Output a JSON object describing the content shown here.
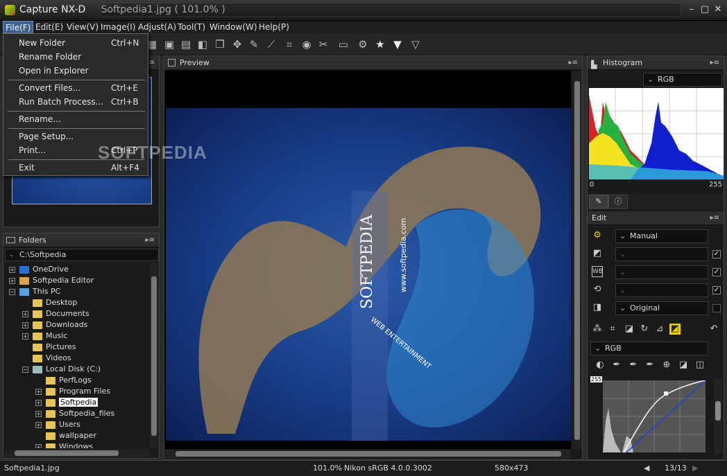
{
  "window": {
    "title": "Capture NX-D     Softpedia1.jpg ( 101.0% )"
  },
  "menubar": [
    "File(F)",
    "Edit(E)",
    "View(V)",
    "Image(I)",
    "Adjust(A)",
    "Tool(T)",
    "Window(W)",
    "Help(P)"
  ],
  "file_menu": {
    "items": [
      {
        "label": "New Folder",
        "key": "Ctrl+N"
      },
      {
        "label": "Rename Folder",
        "key": ""
      },
      {
        "label": "Open in Explorer",
        "key": ""
      },
      {
        "label": "Convert Files...",
        "key": "Ctrl+E"
      },
      {
        "label": "Run Batch Process...",
        "key": "Ctrl+B"
      },
      {
        "label": "Rename...",
        "key": ""
      },
      {
        "label": "Page Setup...",
        "key": ""
      },
      {
        "label": "Print...",
        "key": "Ctrl+P"
      },
      {
        "label": "Exit",
        "key": "Alt+F4"
      }
    ]
  },
  "folders": {
    "title": "Folders",
    "path": "C:\\Softpedia",
    "tree": [
      {
        "label": "OneDrive"
      },
      {
        "label": "Softpedia Editor"
      },
      {
        "label": "This PC"
      },
      {
        "label": "Desktop"
      },
      {
        "label": "Documents"
      },
      {
        "label": "Downloads"
      },
      {
        "label": "Music"
      },
      {
        "label": "Pictures"
      },
      {
        "label": "Videos"
      },
      {
        "label": "Local Disk (C:)"
      },
      {
        "label": "PerfLogs"
      },
      {
        "label": "Program Files"
      },
      {
        "label": "Softpedia"
      },
      {
        "label": "Softpedia_files"
      },
      {
        "label": "Users"
      },
      {
        "label": "wallpaper"
      },
      {
        "label": "Windows"
      }
    ]
  },
  "preview": {
    "title": "Preview",
    "watermark": "SOFTPEDIA",
    "image_text_1": "SOFTPEDIA",
    "image_text_2": "www.softpedia.com",
    "image_text_3": "WEB ENTERTAINMENT"
  },
  "histogram": {
    "title": "Histogram",
    "channel": "RGB",
    "min": "0",
    "max": "255"
  },
  "edit": {
    "title": "Edit",
    "picture_control": "Manual",
    "mode": "Original",
    "curve_channel": "RGB",
    "curve_max": "255"
  },
  "status": {
    "file": "Softpedia1.jpg",
    "zoom": "101.0%",
    "profile": "Nikon sRGB 4.0.0.3002",
    "size": "580x473",
    "page": "13/13"
  }
}
